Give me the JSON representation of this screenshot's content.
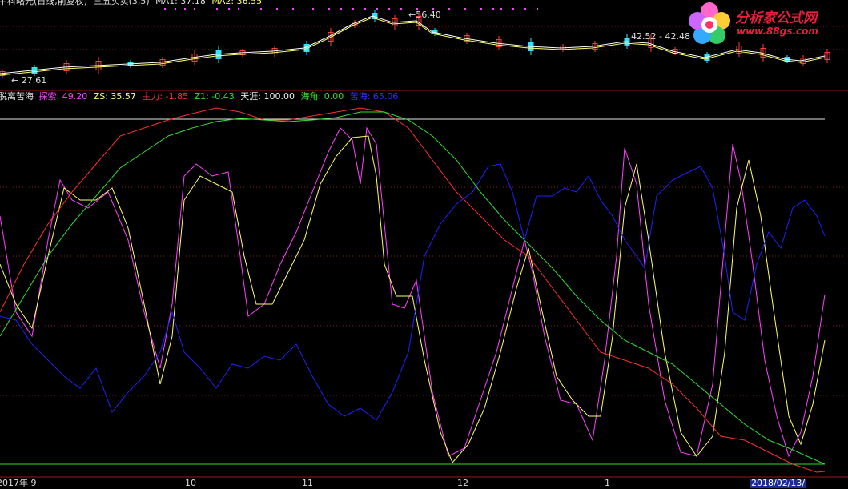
{
  "colors": {
    "background": "#000000",
    "grid": "#8b1a1a",
    "up_candle": "#ff3b3b",
    "down_candle": "#33e0ff",
    "ma1": "#ffffff",
    "ma2": "#ffff66",
    "tansuo": "#ff40ff",
    "zs": "#ffff66",
    "zhuli": "#ff3030",
    "z1": "#33dd33",
    "tianya": "#e8e8e8",
    "haijiao": "#33dd33",
    "kuhai": "#2020ff",
    "signal_dot": "#ff40ff",
    "logo": "#e8203c"
  },
  "main_panel": {
    "title_partial": "中科曙光(日线,前复权)",
    "indicator_name": "三五买卖(3,5)",
    "ma1_label": "MA1: 37.18",
    "ma2_label": "MA2: 36.55",
    "annotation_high": "56.40",
    "annotation_mid": "42.52 - 42.48",
    "annotation_low": "27.61"
  },
  "sub_panel": {
    "name_partial": "脱离苦海",
    "tansuo": "探索: 49.20",
    "zs": "ZS: 35.57",
    "zhuli": "主力: -1.85",
    "z1": "Z1: -0.43",
    "tianya": "天涯: 100.00",
    "haijiao": "海角: 0.00",
    "kuhai": "苦海: 65.06"
  },
  "date_axis": [
    "2017年 9",
    "10",
    "11",
    "12",
    "1",
    "2018/02/13/"
  ],
  "logo": {
    "name": "分析家公式网",
    "url_text": "www.88gs.com"
  },
  "icons": [
    "flower-logo-icon"
  ]
}
